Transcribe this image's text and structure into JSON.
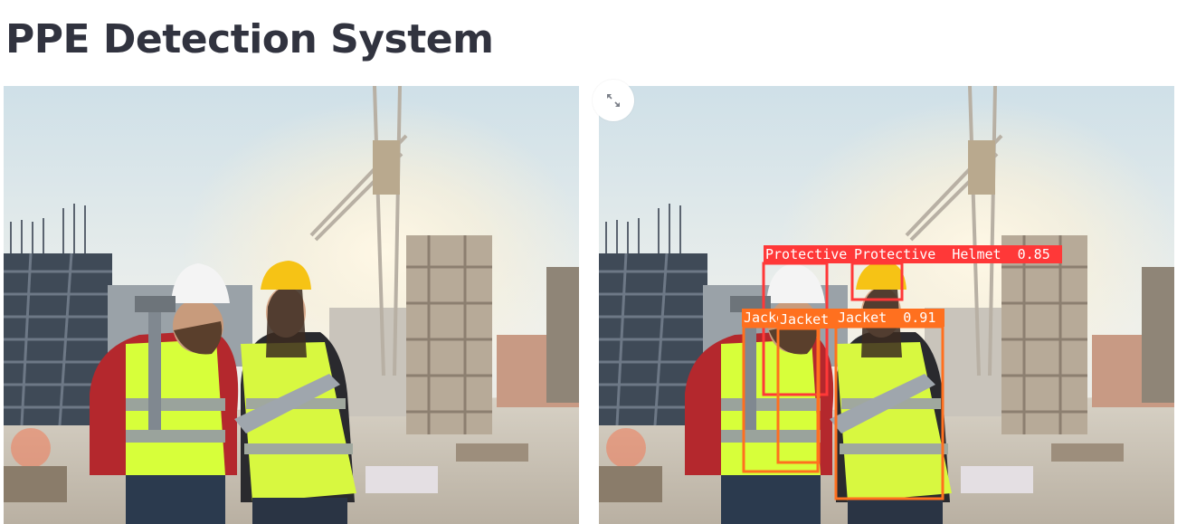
{
  "page": {
    "title": "PPE Detection System"
  },
  "images": {
    "original": {
      "name": "original-photo"
    },
    "annotated": {
      "name": "detection-result-photo"
    }
  },
  "toolbar": {
    "expand_icon": "fullscreen-expand-icon"
  },
  "detections": [
    {
      "label": "Protective",
      "color": "#ff3838"
    },
    {
      "label": "Protective  Helmet  0.85",
      "color": "#ff3838"
    },
    {
      "label": "Jacket  0.5",
      "color": "#ff701f"
    },
    {
      "label": "Jacket",
      "color": "#ff701f"
    },
    {
      "label": "Jacket  0.91",
      "color": "#ff701f"
    }
  ],
  "colors": {
    "title": "#31333f",
    "helmet_box": "#ff3838",
    "jacket_box": "#ff701f"
  }
}
